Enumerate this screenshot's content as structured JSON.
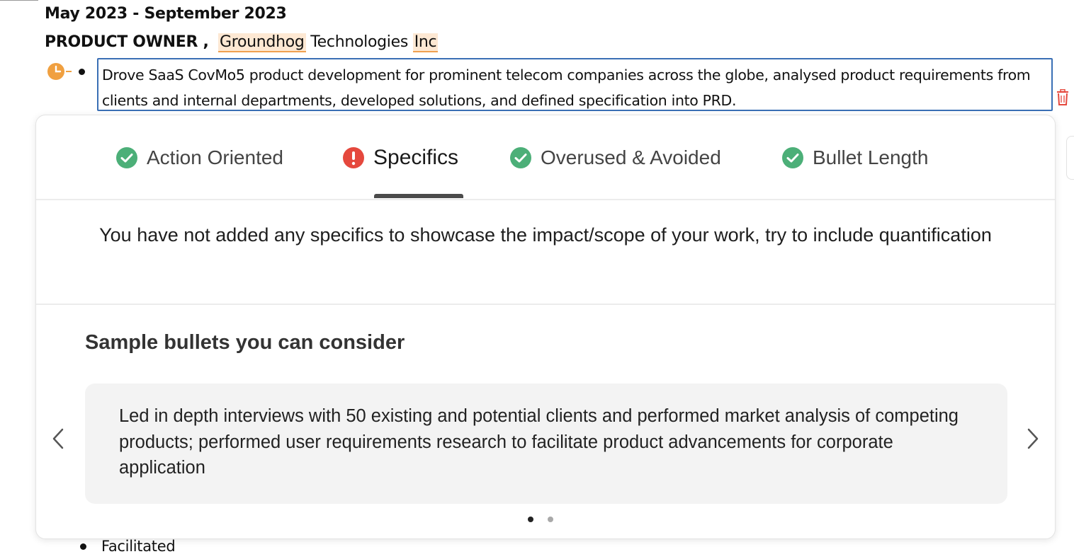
{
  "experience": {
    "date_range": "May 2023 - September 2023",
    "role": "PRODUCT OWNER ,",
    "company_part1": "Groundhog",
    "company_part2": "Technologies",
    "company_part3": "Inc",
    "bullet_text": "Drove SaaS CovMo5 product development  for prominent telecom companies across the globe, analysed product requirements from clients and internal departments, developed solutions, and defined specification into PRD.",
    "next_bullet_text": "Facilitated"
  },
  "feedback_panel": {
    "tabs": [
      {
        "label": "Action Oriented",
        "status": "pass",
        "icon": "check-circle-icon"
      },
      {
        "label": "Specifics",
        "status": "fail",
        "icon": "exclamation-circle-icon"
      },
      {
        "label": "Overused & Avoided",
        "status": "pass",
        "icon": "check-circle-icon"
      },
      {
        "label": "Bullet Length",
        "status": "pass",
        "icon": "check-circle-icon"
      }
    ],
    "active_tab": "Specifics",
    "message": "You have not added any specifics to showcase the impact/scope of your work, try to include quantification",
    "sample_heading": "Sample bullets you can consider",
    "sample_bullet": "Led in depth interviews with 50 existing and potential clients and performed market analysis of competing products; performed user requirements research to facilitate product advancements for corporate application",
    "carousel": {
      "total": 2,
      "current": 1
    }
  },
  "colors": {
    "pass_green": "#4caf78",
    "fail_red": "#e5483d",
    "warning_orange": "#f0a040",
    "focus_blue": "#3a6fb5",
    "trash_red": "#e5483d"
  }
}
